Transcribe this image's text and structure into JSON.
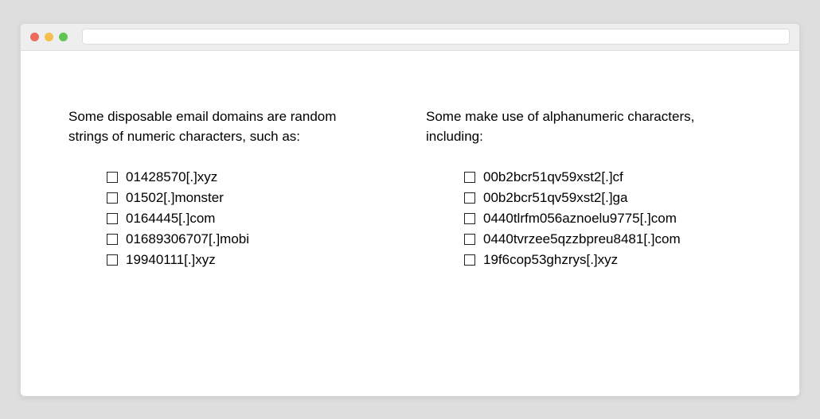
{
  "titlebar": {
    "address_value": ""
  },
  "columns": [
    {
      "heading": "Some disposable email domains are random strings of numeric characters, such as:",
      "items": [
        "01428570[.]xyz",
        "01502[.]monster",
        "0164445[.]com",
        "01689306707[.]mobi",
        "19940111[.]xyz"
      ]
    },
    {
      "heading": "Some make use of alphanumeric characters, including:",
      "items": [
        "00b2bcr51qv59xst2[.]cf",
        "00b2bcr51qv59xst2[.]ga",
        "0440tlrfm056aznoelu9775[.]com",
        "0440tvrzee5qzzbpreu8481[.]com",
        "19f6cop53ghzrys[.]xyz"
      ]
    }
  ]
}
